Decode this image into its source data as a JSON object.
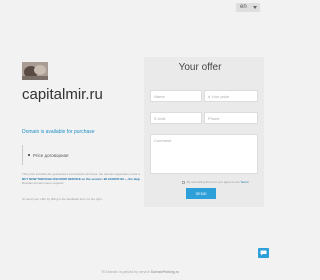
{
  "lang": {
    "label": "en"
  },
  "domain": {
    "name": "capitalmir.ru",
    "available_text": "Domain is available for purchase"
  },
  "price": {
    "label": "Price договорная"
  },
  "terms_lines": [
    {
      "text": "This price includes the guarantee's commission and fees, the domain registration costs at our own",
      "strong": false
    },
    {
      "text": "BUY NOW THROUGH ESCROW SERVICE on the service: 98 1234567-89 — the largest",
      "strong": true
    },
    {
      "text": "Russian domain name registrar",
      "strong": false
    }
  ],
  "contact_note": "Or send your offer by filling in the feedback form on the right.",
  "offer": {
    "title": "Your offer",
    "name_placeholder": "Name",
    "price_placeholder": "# Your price",
    "email_placeholder": "E-mail",
    "phone_placeholder": "Phone",
    "comment_placeholder": "Comment",
    "terms_prefix": "By submitting this form you agree to the",
    "terms_link": "Terms",
    "send_label": "SEND"
  },
  "footer": {
    "prefix": "Tti Domain is parked by service",
    "link": "DomainParking.ru"
  },
  "colors": {
    "accent": "#2d9fd9",
    "link": "#1e90c6",
    "background": "#f2f2f2",
    "panel": "#eaeaea"
  },
  "icons": {
    "chat": "chat-bubble-icon",
    "caret": "chevron-down-icon"
  }
}
